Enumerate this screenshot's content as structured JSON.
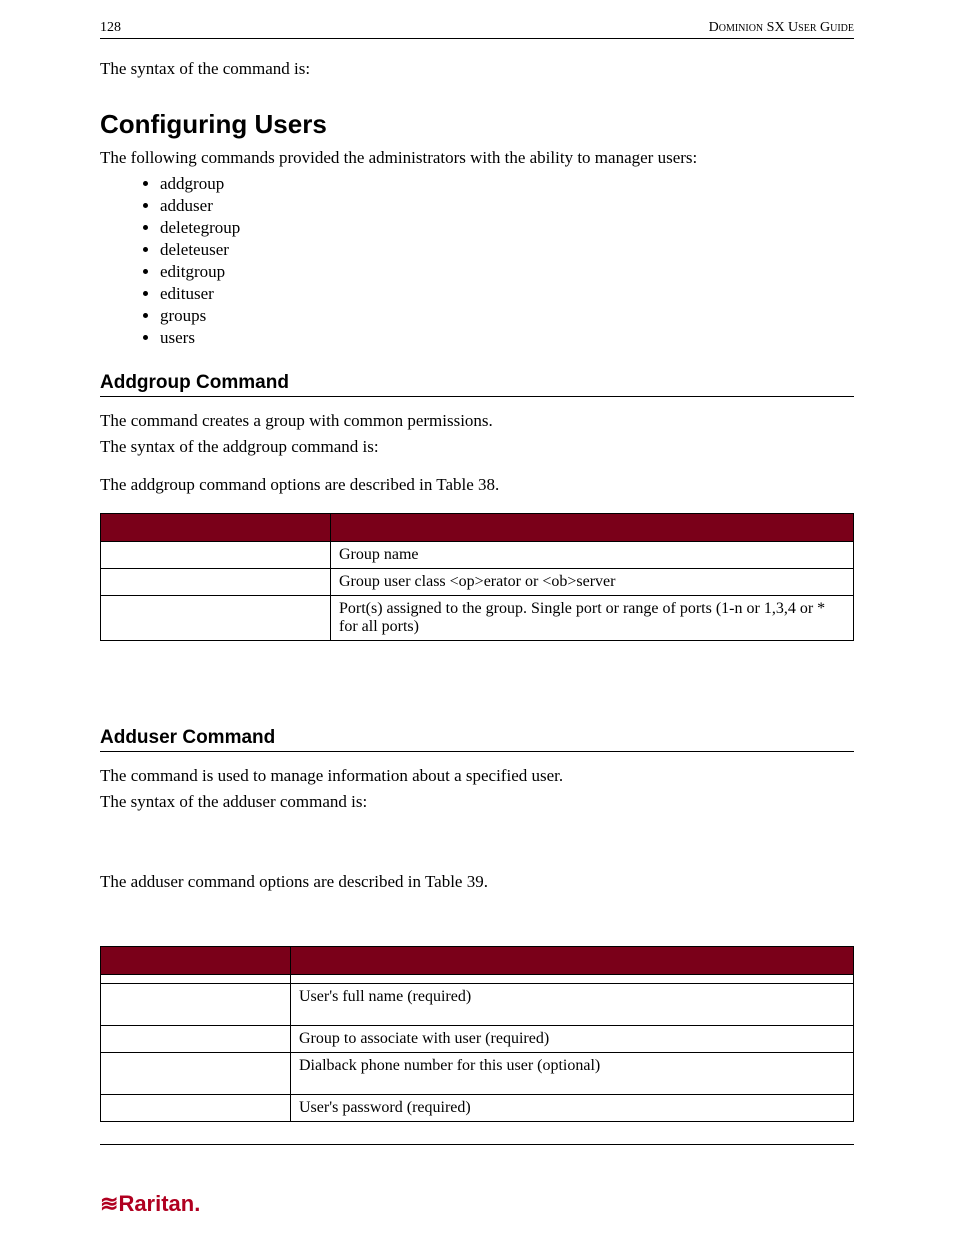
{
  "header": {
    "page_number": "128",
    "guide_title": "Dominion SX User Guide"
  },
  "intro_line": "The syntax of the command is:",
  "section_configuring": {
    "title": "Configuring Users",
    "intro": "The following commands provided the administrators with the ability to manager users:",
    "bullets": [
      "addgroup",
      "adduser",
      "deletegroup",
      "deleteuser",
      "editgroup",
      "edituser",
      "groups",
      "users"
    ]
  },
  "section_addgroup": {
    "title": "Addgroup Command",
    "line1_pre": "The ",
    "line1_post": " command creates a group with common permissions.",
    "syntax_intro": "The syntax of the addgroup command is:",
    "options_intro": "The addgroup command options are described in Table 38.",
    "table": {
      "rows": [
        {
          "opt": "",
          "desc": "Group name"
        },
        {
          "opt": "",
          "desc": "Group user class <op>erator or <ob>server"
        },
        {
          "opt": "",
          "desc": "Port(s) assigned to the group. Single port or range of ports (1-n or 1,3,4 or * for all ports)"
        }
      ]
    }
  },
  "section_adduser": {
    "title": "Adduser Command",
    "line1_pre": "The ",
    "line1_post": " command is used to manage information about a specified user.",
    "syntax_intro": "The syntax of the adduser command is:",
    "options_intro": "The adduser command options are described in Table 39.",
    "table": {
      "rows": [
        {
          "opt": "",
          "desc": ""
        },
        {
          "opt": "",
          "desc": "User's full name (required)"
        },
        {
          "opt": "",
          "desc": "Group to associate with user (required)"
        },
        {
          "opt": "",
          "desc": "Dialback phone number for this user (optional)"
        },
        {
          "opt": "",
          "desc": "User's password (required)"
        }
      ]
    }
  },
  "logo_text": "Raritan."
}
